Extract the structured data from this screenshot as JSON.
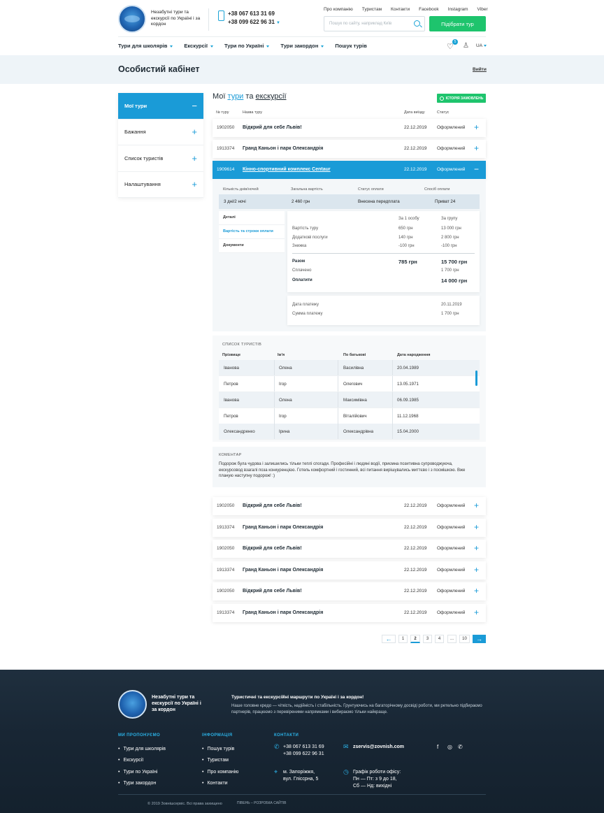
{
  "header": {
    "slogan": "Незабутні тури та екскурсії по Україні і за кордон",
    "phone1": "+38 067 613 31 69",
    "phone2": "+38 099 622 96 31",
    "top_links": [
      "Про компанію",
      "Туристам",
      "Контакти",
      "Facebook",
      "Instagram",
      "Viber"
    ],
    "search_placeholder": "Пошук по сайту, наприклад Київ",
    "pick_tour": "Підібрати тур",
    "nav": [
      "Тури для школярів",
      "Екскурсії",
      "Тури по Україні",
      "Тури закордон",
      "Пошук турів"
    ],
    "wishlist_count": "5",
    "lang": "UA"
  },
  "page": {
    "title": "Особистий кабінет",
    "logout": "Вийти"
  },
  "sidebar": {
    "items": [
      {
        "label": "Мої тури",
        "icon": "minus"
      },
      {
        "label": "Бажання",
        "icon": "plus"
      },
      {
        "label": "Список туристів",
        "icon": "plus"
      },
      {
        "label": "Налаштування",
        "icon": "plus"
      }
    ]
  },
  "tours": {
    "title_prefix": "Мої",
    "title_link1": "тури",
    "title_mid": "та",
    "title_link2": "екскурсії",
    "history_btn": "ІСТОРІЯ ЗАМОВЛЕНЬ",
    "headers": [
      "№ туру",
      "Назва туру",
      "Дата виїзду",
      "Статус"
    ],
    "rows_top": [
      {
        "num": "1902050",
        "name": "Відкрий для себе Львів!",
        "date": "22.12.2019",
        "status": "Оформлений"
      },
      {
        "num": "1913374",
        "name": "Гранд Каньон і парк Олександрія",
        "date": "22.12.2019",
        "status": "Оформлений"
      },
      {
        "num": "1909614",
        "name": "Кінно-спортивний комплекс Centaur",
        "date": "22.12.2019",
        "status": "Оформлений"
      }
    ],
    "rows_bottom": [
      {
        "num": "1902050",
        "name": "Відкрий для себе Львів!",
        "date": "22.12.2019",
        "status": "Оформлений"
      },
      {
        "num": "1913374",
        "name": "Гранд Каньон і парк Олександрія",
        "date": "22.12.2019",
        "status": "Оформлений"
      },
      {
        "num": "1902050",
        "name": "Відкрий для себе Львів!",
        "date": "22.12.2019",
        "status": "Оформлений"
      },
      {
        "num": "1913374",
        "name": "Гранд Каньон і парк Олександрія",
        "date": "22.12.2019",
        "status": "Оформлений"
      },
      {
        "num": "1902050",
        "name": "Відкрий для себе Львів!",
        "date": "22.12.2019",
        "status": "Оформлений"
      },
      {
        "num": "1913374",
        "name": "Гранд Каньон і парк Олександрія",
        "date": "22.12.2019",
        "status": "Оформлений"
      }
    ]
  },
  "details": {
    "summary_headers": [
      "Кількість днів/ночей",
      "Загальна вартість",
      "Статус оплати",
      "Спосіб оплати"
    ],
    "summary_values": [
      "3 дні/2 ночі",
      "2 460 грн",
      "Внесена передплата",
      "Приват 24"
    ],
    "tabs": [
      "Деталі",
      "Вартість та строки оплати",
      "Документи"
    ],
    "price_headers": [
      "За 1 особу",
      "За групу"
    ],
    "price_rows": [
      {
        "label": "Вартість туру",
        "one": "650 грн",
        "group": "13 000 грн"
      },
      {
        "label": "Додаткові послуги",
        "one": "140 грн",
        "group": "2 800 грн"
      },
      {
        "label": "Знижка",
        "one": "-100 грн",
        "group": "-100 грн"
      }
    ],
    "total_label": "Разом",
    "total_one": "785 грн",
    "total_group": "15 700 грн",
    "paid_label": "Сплачено",
    "paid_value": "1 700 грн",
    "topay_label": "Оплатити",
    "topay_value": "14 000 грн",
    "pay_date_label": "Дата платежу",
    "pay_date_value": "20.11.2019",
    "pay_sum_label": "Сумма платежу",
    "pay_sum_value": "1 700 грн"
  },
  "tourists": {
    "title": "СПИСОК ТУРИСТІВ",
    "headers": [
      "Прізвище",
      "Ім'я",
      "По батькові",
      "Дата народження"
    ],
    "rows": [
      [
        "Іванова",
        "Олена",
        "Василівна",
        "20.04.1989"
      ],
      [
        "Петров",
        "Ігор",
        "Олегович",
        "13.05.1971"
      ],
      [
        "Іванова",
        "Олена",
        "Максимівна",
        "06.09.1985"
      ],
      [
        "Петров",
        "Ігор",
        "Віталійович",
        "11.12.1968"
      ],
      [
        "Олександренко",
        "Ірина",
        "Олександрівна",
        "15.04.2000"
      ]
    ]
  },
  "comment": {
    "title": "КОМЕНТАР",
    "text": "Подорож була чудова і залишились тільки теплі спогади. Професійні і людяні водії, приємна позитивна супроводжуюча, екскурсовод взагалі поза конкуренцією. Готель комфортний і гостинний, всі питання вирішувались миттєво і з посмішкою. Вже планую наступну подорож! :)"
  },
  "pagination": {
    "pages": [
      "1",
      "2",
      "3",
      "4",
      "...",
      "10"
    ],
    "current": "2"
  },
  "footer": {
    "slogan": "Незабутні тури та екскурсії по Україні і за кордон",
    "heading": "Туристичні та екскурсійні маршрути по Україні і за кордон!",
    "para": "Наше головне кредо — чіткість, надійність і стабільність. Грунтуючись на багаторічному досвіді роботи, ми ретельно підбираємо партнерів, працюємо з перевіреними напрямками і вибираємо тільки найкраще.",
    "col1_title": "МИ ПРОПОНУЄМО",
    "col1": [
      "Тури для школярів",
      "Екскурсії",
      "Тури по Україні",
      "Тури закордон"
    ],
    "col2_title": "ІНФОРМАЦІЯ",
    "col2": [
      "Пошук турів",
      "Туристам",
      "Про компанію",
      "Контакти"
    ],
    "col3_title": "КОНТАКТИ",
    "phone1": "+38 067 613 31 69",
    "phone2": "+38 099 622 96 31",
    "email": "zservis@zovnish.com",
    "address1": "м. Запоріжжя,",
    "address2": "вул. Гліссрна, 5",
    "hours_title": "Графік роботи офісу:",
    "hours1": "Пн — Пт: з 9 до 18,",
    "hours2": "Сб — Нд: вихідні",
    "copyright": "© 2019 Зовнішсервіс. Всі права захищено",
    "developer": "ПІВЕНЬ – РОЗРОБКА САЙТІВ"
  }
}
